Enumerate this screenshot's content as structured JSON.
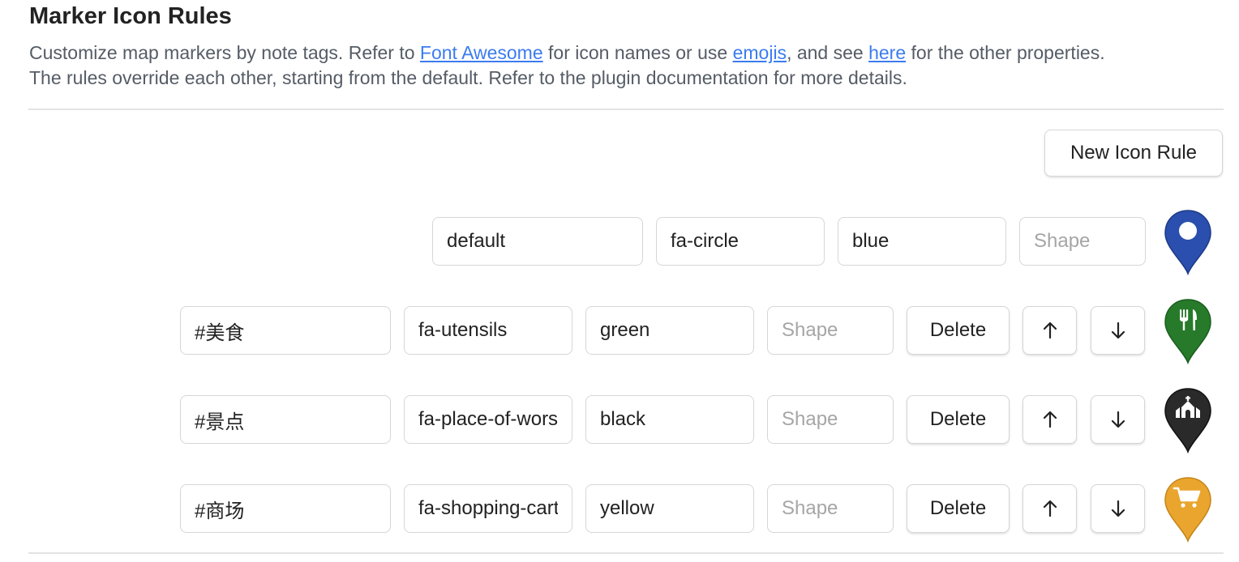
{
  "header": {
    "title": "Marker Icon Rules",
    "desc_part1": "Customize map markers by note tags. Refer to ",
    "link_font_awesome": "Font Awesome",
    "desc_part2": " for icon names or use ",
    "link_emojis": "emojis",
    "desc_part3": ", and see ",
    "link_here": "here",
    "desc_part4": " for the other properties.",
    "desc_line2": "The rules override each other, starting from the default. Refer to the plugin documentation for more details."
  },
  "new_rule_label": "New Icon Rule",
  "default_rule": {
    "tag": "default",
    "icon": "fa-circle",
    "color": "blue",
    "shape_value": "",
    "shape_placeholder": "Shape",
    "marker_icon": "circle-icon",
    "marker_color": "#2a4fae"
  },
  "rules": [
    {
      "tag": "#美食",
      "icon": "fa-utensils",
      "color": "green",
      "shape_value": "",
      "shape_placeholder": "Shape",
      "delete_label": "Delete",
      "up_arrow": "↑",
      "down_arrow": "↓",
      "marker_icon": "utensils-icon",
      "marker_color": "#267a2a"
    },
    {
      "tag": "#景点",
      "icon": "fa-place-of-worship",
      "color": "black",
      "shape_value": "",
      "shape_placeholder": "Shape",
      "delete_label": "Delete",
      "up_arrow": "↑",
      "down_arrow": "↓",
      "marker_icon": "place-of-worship-icon",
      "marker_color": "#2a2a2a"
    },
    {
      "tag": "#商场",
      "icon": "fa-shopping-cart",
      "color": "yellow",
      "shape_value": "",
      "shape_placeholder": "Shape",
      "delete_label": "Delete",
      "up_arrow": "↑",
      "down_arrow": "↓",
      "marker_icon": "shopping-cart-icon",
      "marker_color": "#e9a52e"
    }
  ]
}
